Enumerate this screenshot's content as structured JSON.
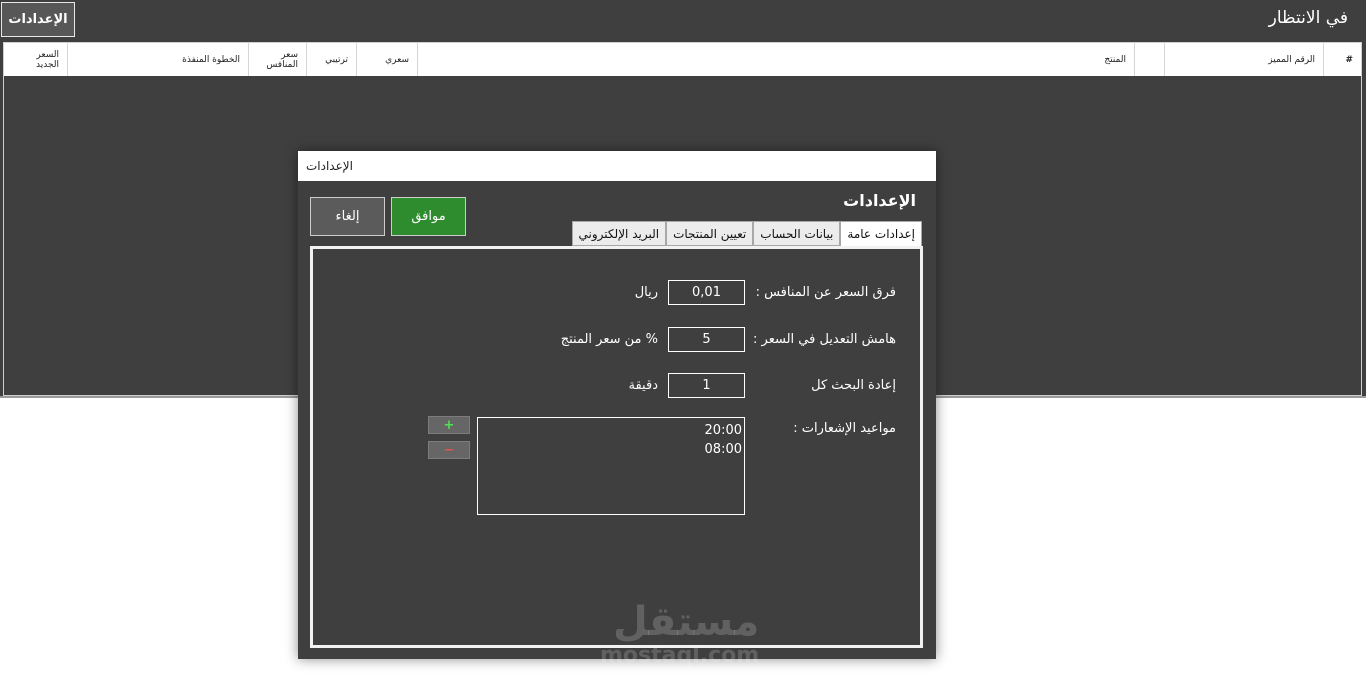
{
  "app": {
    "title": "في الانتظار",
    "settings_button": "الإعدادات"
  },
  "grid": {
    "columns": {
      "hash": "#",
      "id": "الرقم المميز",
      "product": "المنتج",
      "my_price": "سعري",
      "rank": "ترتيبي",
      "competitor_price": "سعر المنافس",
      "step": "الخطوة المنفذة",
      "new_price": "السعر الجديد"
    }
  },
  "dialog": {
    "window_title": "الإعدادات",
    "heading": "الإعدادات",
    "ok_label": "موافق",
    "cancel_label": "إلغاء",
    "tabs": [
      {
        "label": "إعدادات عامة",
        "active": true
      },
      {
        "label": "بيانات الحساب",
        "active": false
      },
      {
        "label": "تعيين المنتجات",
        "active": false
      },
      {
        "label": "البريد الإلكتروني",
        "active": false
      }
    ],
    "general": {
      "price_diff_label": "فرق السعر عن المنافس :",
      "price_diff_value": "0,01",
      "price_diff_unit": "ريال",
      "margin_label": "هامش  التعديل في السعر :",
      "margin_value": "5",
      "margin_unit": "% من سعر المنتج",
      "refresh_label": "إعادة البحث كل",
      "refresh_value": "1",
      "refresh_unit": "دقيقة",
      "schedule_label": "مواعيد الإشعارات :",
      "schedule_times": [
        "20:00",
        "08:00"
      ],
      "add_symbol": "+",
      "remove_symbol": "−"
    }
  },
  "watermark": {
    "arabic": "مستقل",
    "latin": "mostaql.com"
  }
}
